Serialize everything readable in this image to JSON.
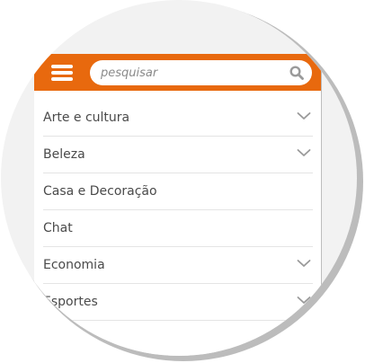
{
  "header": {
    "menu_icon": "hamburger-menu-icon",
    "search": {
      "placeholder": "pesquisar",
      "icon": "search-icon"
    },
    "accent_color": "#e8690e"
  },
  "menu": {
    "items": [
      {
        "label": "Arte e cultura",
        "has_submenu": true
      },
      {
        "label": "Beleza",
        "has_submenu": true
      },
      {
        "label": "Casa e Decoração",
        "has_submenu": false
      },
      {
        "label": "Chat",
        "has_submenu": false
      },
      {
        "label": "Economia",
        "has_submenu": true
      },
      {
        "label": "Esportes",
        "has_submenu": true
      }
    ]
  }
}
